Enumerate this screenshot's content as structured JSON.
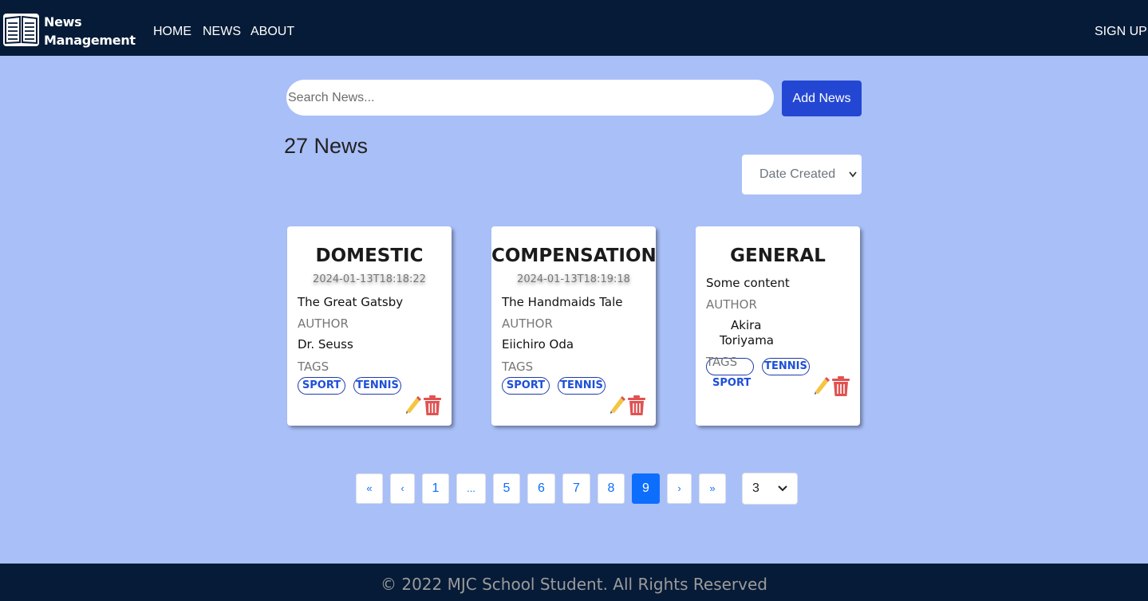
{
  "navbar": {
    "brand_line1": "News",
    "brand_line2": "Management",
    "links": [
      "HOME",
      "NEWS",
      "ABOUT"
    ],
    "signup": "SIGN UP"
  },
  "search": {
    "placeholder": "Search News...",
    "value": ""
  },
  "add_button": "Add News",
  "news_count": "27 News",
  "sort": {
    "selected": "Date Created"
  },
  "labels": {
    "author": "AUTHOR",
    "tags": "TAGS"
  },
  "cards": [
    {
      "title": "DOMESTIC",
      "date": "2024-01-13T18:18:22",
      "content": "The Great Gatsby",
      "author": "Dr. Seuss",
      "tags": [
        "SPORT",
        "TENNIS"
      ]
    },
    {
      "title": "COMPENSATION",
      "date": "2024-01-13T18:19:18",
      "content": "The Handmaids Tale",
      "author": "Eiichiro Oda",
      "tags": [
        "SPORT",
        "TENNIS"
      ]
    },
    {
      "title": "GENERAL",
      "date": "",
      "content": "Some content",
      "author_line1": "Akira",
      "author_line2": "Toriyama",
      "tags": [
        "SPORT",
        "TENNIS"
      ]
    }
  ],
  "pagination": {
    "first": "«",
    "prev": "‹",
    "pages": [
      "1",
      "...",
      "5",
      "6",
      "7",
      "8",
      "9"
    ],
    "active": "9",
    "next": "›",
    "last": "»",
    "page_size": "3"
  },
  "footer": "© 2022 MJC School Student. All Rights Reserved",
  "colors": {
    "navbar": "#061b37",
    "background": "#a9bff8",
    "primary": "#2447d3",
    "active_page": "#0d6efd",
    "tag_border": "#1d3ba9",
    "trash": "#e05252"
  },
  "icons": [
    "book-logo-icon",
    "pencil-icon",
    "trash-icon",
    "chevron-down-icon"
  ]
}
